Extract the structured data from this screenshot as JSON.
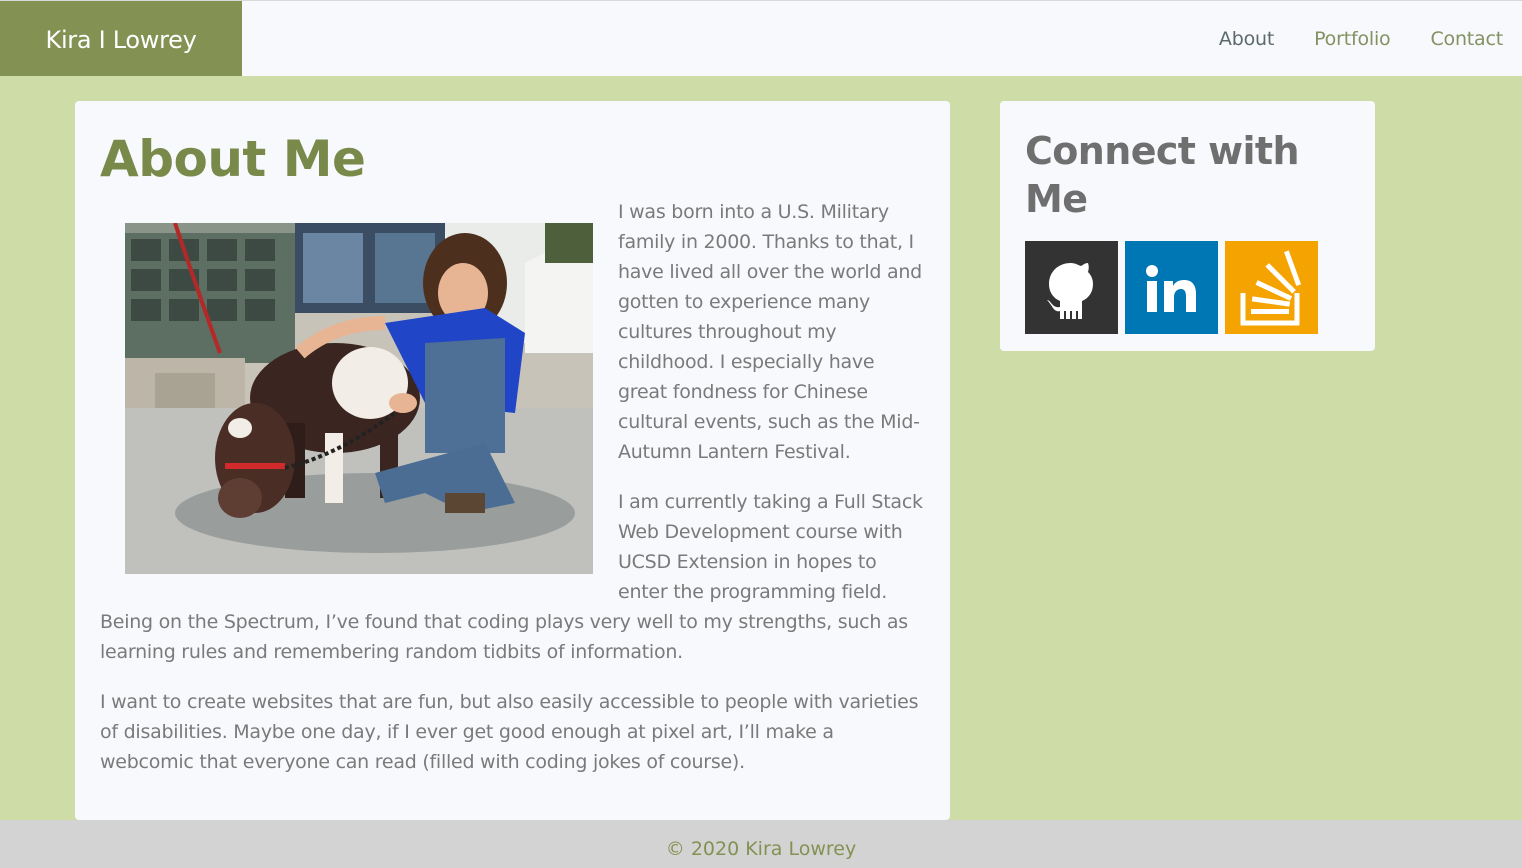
{
  "brand": {
    "name": "Kira I Lowrey"
  },
  "nav": {
    "items": [
      {
        "label": "About"
      },
      {
        "label": "Portfolio"
      },
      {
        "label": "Contact"
      }
    ]
  },
  "about": {
    "title": "About Me",
    "paragraphs": [
      "I was born into a U.S. Military family in 2000. Thanks to that, I have lived all over the world and gotten to experience many cultures throughout my childhood. I especially have great fondness for Chinese cultural events, such as the Mid-Autumn Lantern Festival.",
      "I am currently taking a Full Stack Web Development course with UCSD Extension in hopes to enter the programming field. Being on the Spectrum, I’ve found that coding plays very well to my strengths, such as learning rules and remembering random tidbits of information.",
      "I want to create websites that are fun, but also easily accessible to people with varieties of disabilities. Maybe one day, if I ever get good enough at pixel art, I’ll make a webcomic that everyone can read (filled with coding jokes of course)."
    ]
  },
  "connect": {
    "title": "Connect with Me",
    "links": [
      {
        "icon": "github-icon",
        "color": "#333333"
      },
      {
        "icon": "linkedin-icon",
        "color": "#0077b5"
      },
      {
        "icon": "stackoverflow-icon",
        "color": "#f5a300"
      }
    ]
  },
  "footer": {
    "text": "© 2020 Kira Lowrey"
  },
  "colors": {
    "page_background": "#cedca8",
    "brand_background": "#839153",
    "card_background": "#f7f9fc",
    "heading_green": "#78894a",
    "footer_background": "#d3d3d3"
  }
}
